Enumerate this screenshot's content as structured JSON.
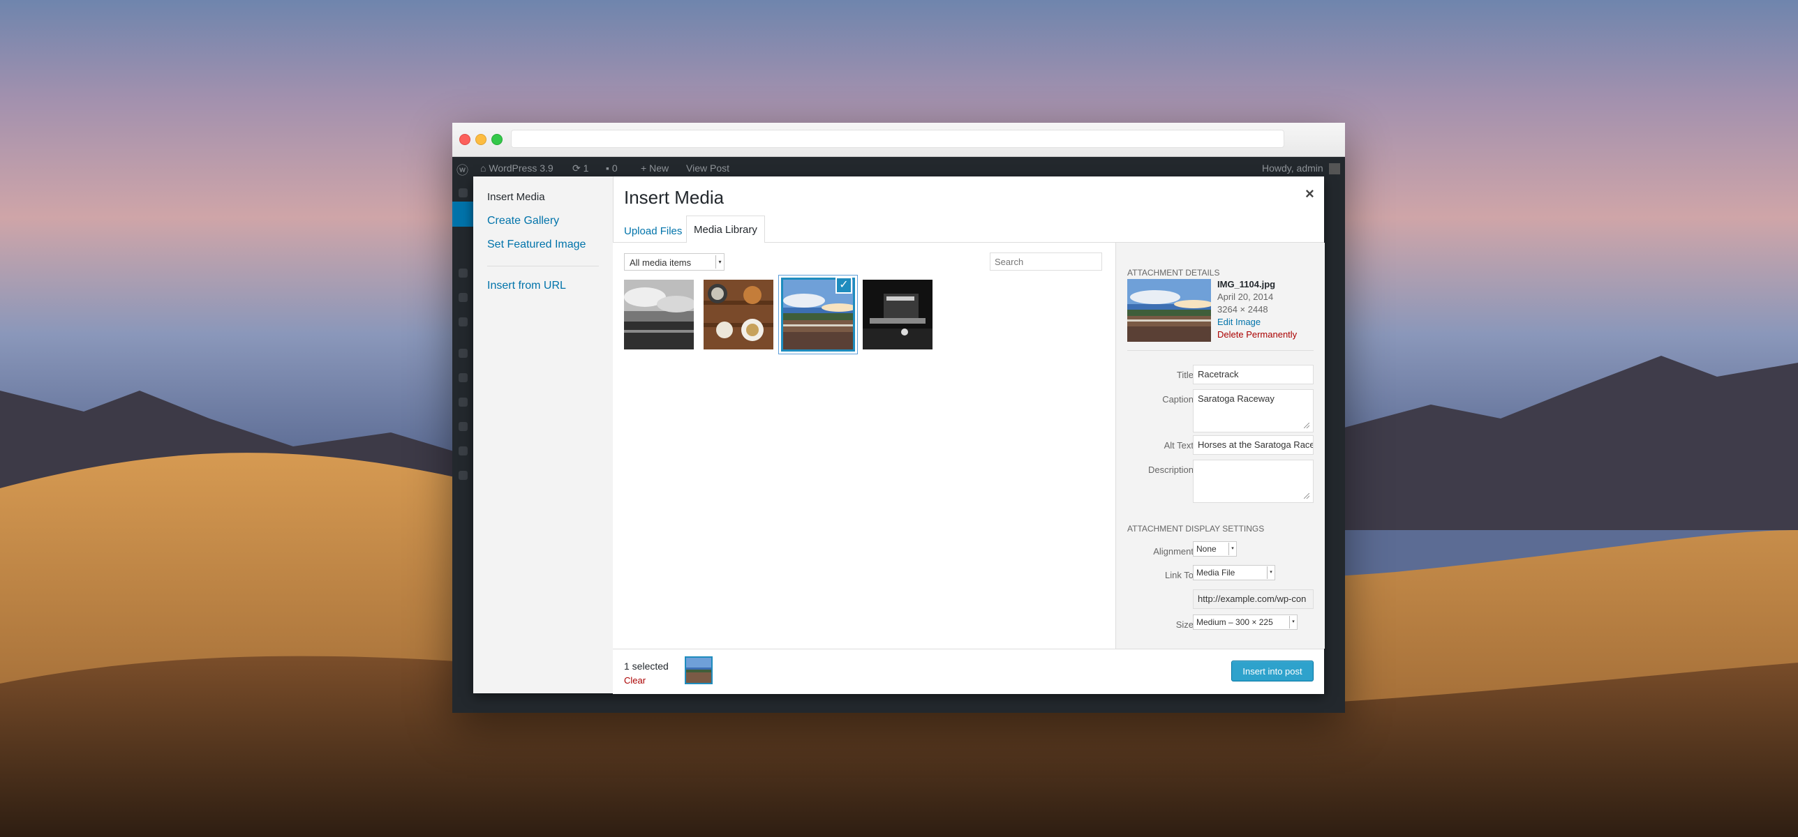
{
  "admin_bar": {
    "site_name": "WordPress 3.9",
    "updates_count": "1",
    "comments_count": "0",
    "new_label": "New",
    "view_post_label": "View Post",
    "greeting": "Howdy, admin"
  },
  "modal": {
    "title": "Insert Media",
    "close_glyph": "×",
    "nav": {
      "insert_media": "Insert Media",
      "create_gallery": "Create Gallery",
      "set_featured_image": "Set Featured Image",
      "insert_from_url": "Insert from URL"
    },
    "tabs": {
      "upload_files": "Upload Files",
      "media_library": "Media Library"
    },
    "filter": {
      "selected": "All media items"
    },
    "search": {
      "placeholder": "Search"
    }
  },
  "attachment_details": {
    "heading": "Attachment Details",
    "filename": "IMG_1104.jpg",
    "date": "April 20, 2014",
    "dimensions": "3264 × 2448",
    "edit_image": "Edit Image",
    "delete_permanently": "Delete Permanently",
    "title_label": "Title",
    "title_value": "Racetrack",
    "caption_label": "Caption",
    "caption_value": "Saratoga Raceway",
    "alt_label": "Alt Text",
    "alt_value": "Horses at the Saratoga Race",
    "description_label": "Description",
    "description_value": ""
  },
  "display_settings": {
    "heading": "Attachment Display Settings",
    "alignment_label": "Alignment",
    "alignment_value": "None",
    "link_to_label": "Link To",
    "link_to_value": "Media File",
    "link_url": "http://example.com/wp-con",
    "size_label": "Size",
    "size_value": "Medium – 300 × 225"
  },
  "toolbar": {
    "selected_count": "1 selected",
    "clear_label": "Clear",
    "insert_button": "Insert into post"
  },
  "colors": {
    "accent": "#0073aa",
    "primary_button": "#2ea2cc",
    "danger": "#a00000"
  }
}
